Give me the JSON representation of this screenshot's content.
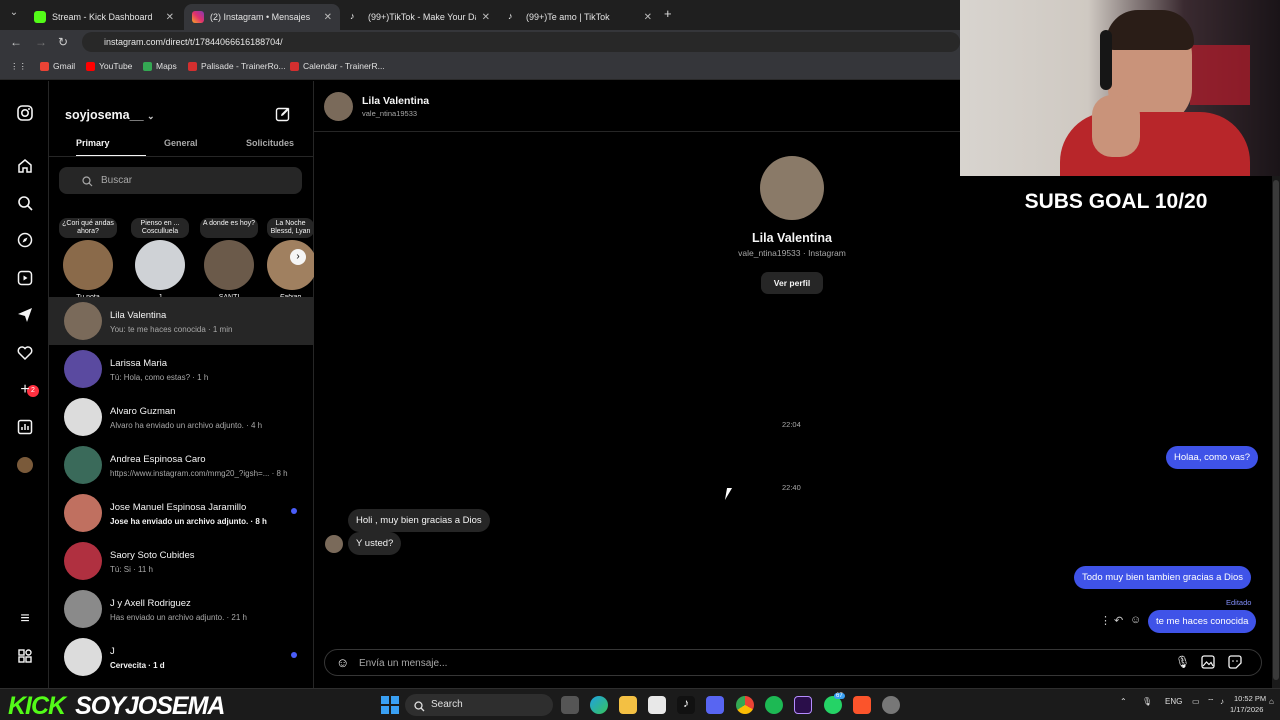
{
  "browser": {
    "tabs": [
      {
        "title": "Stream - Kick Dashboard",
        "color": "#53fc18"
      },
      {
        "title": "(2) Instagram • Mensajes",
        "color": "#e1306c"
      },
      {
        "title": "(99+)TikTok - Make Your Day",
        "color": "#ffffff"
      },
      {
        "title": "(99+)Te amo | TikTok",
        "color": "#ffffff"
      }
    ],
    "url": "instagram.com/direct/t/17844066616188704/",
    "bookmarks": [
      {
        "label": "Gmail",
        "color": "#ea4335"
      },
      {
        "label": "YouTube",
        "color": "#ff0000"
      },
      {
        "label": "Maps",
        "color": "#34a853"
      },
      {
        "label": "Palisade - TrainerRo...",
        "color": "#d32f2f"
      },
      {
        "label": "Calendar - TrainerR...",
        "color": "#d32f2f"
      }
    ]
  },
  "sidebar": {
    "username": "soyjosema__",
    "notification_count": "2"
  },
  "inbox": {
    "tabs": [
      "Primary",
      "General",
      "Solicitudes"
    ],
    "search_placeholder": "Buscar",
    "notes": [
      {
        "bubble": "¿Cori qué andas ahora?",
        "name": "Tu nota",
        "color": "#8a6a4a"
      },
      {
        "bubble": "Pienso en ... Cosculluela",
        "name": "J",
        "color": "#9aa0a6"
      },
      {
        "bubble": "A donde es hoy?",
        "name": "SANTI",
        "color": "#6b5a4a"
      },
      {
        "bubble": "La Noche Blessd, Lyan",
        "name": "Fabian",
        "color": "#a08060"
      }
    ],
    "conversations": [
      {
        "name": "Lila Valentina",
        "preview": "You: te me haces conocida · 1 min",
        "unread": false,
        "color": "#7a6a5a"
      },
      {
        "name": "Larissa Maria",
        "preview": "Tú: Hola, como estas? · 1 h",
        "unread": false,
        "color": "#5a4aa0"
      },
      {
        "name": "Alvaro Guzman",
        "preview": "Alvaro ha enviado un archivo adjunto. · 4 h",
        "unread": false,
        "color": "#dcdcdc"
      },
      {
        "name": "Andrea Espinosa Caro",
        "preview": "https://www.instagram.com/mmg20_?igsh=... · 8 h",
        "unread": false,
        "color": "#3a6a5a"
      },
      {
        "name": "Jose Manuel Espinosa Jaramillo",
        "preview": "Jose ha enviado un archivo adjunto. · 8 h",
        "unread": true,
        "color": "#c07060"
      },
      {
        "name": "Saory Soto Cubides",
        "preview": "Tú: Si · 11 h",
        "unread": false,
        "color": "#b03040"
      },
      {
        "name": "J y Axell Rodriguez",
        "preview": "Has enviado un archivo adjunto. · 21 h",
        "unread": false,
        "color": "#8a8a8a"
      },
      {
        "name": "J",
        "preview": "Cervecita · 1 d",
        "unread": true,
        "color": "#dcdcdc"
      }
    ]
  },
  "chat": {
    "name": "Lila Valentina",
    "username": "vale_ntina19533",
    "profile_sub": "vale_ntina19533 · Instagram",
    "view_profile": "Ver perfil",
    "time1": "22:04",
    "time2": "22:40",
    "messages": {
      "out1": "Holaa, como vas?",
      "in1": "Holi , muy bien gracias a Dios",
      "in2": "Y usted?",
      "out2": "Todo muy bien tambien gracias a Dios",
      "edited": "Editado",
      "out3": "te me haces conocida"
    },
    "composer_placeholder": "Envía un mensaje..."
  },
  "overlay": {
    "subs_goal": "SUBS GOAL 10/20",
    "brand_a": "KICK",
    "brand_b": "SOYJOSEMA"
  },
  "taskbar": {
    "search": "Search",
    "lang": "ENG",
    "time": "10:52 PM",
    "date": "1/17/2026",
    "badge": "67"
  }
}
